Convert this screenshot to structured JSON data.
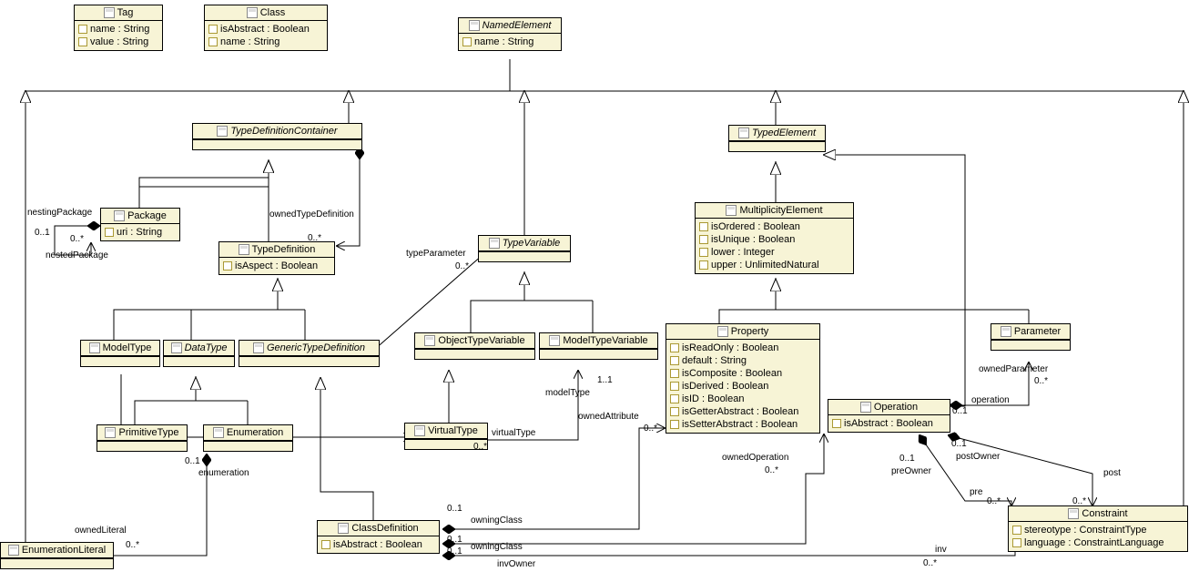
{
  "classes": {
    "Tag": {
      "name": "Tag",
      "italic": false,
      "attrs": [
        "name : String",
        "value : String"
      ]
    },
    "Class": {
      "name": "Class",
      "italic": false,
      "attrs": [
        "isAbstract : Boolean",
        "name : String"
      ]
    },
    "NamedElement": {
      "name": "NamedElement",
      "italic": true,
      "attrs": [
        "name : String"
      ]
    },
    "TypeDefinitionContainer": {
      "name": "TypeDefinitionContainer",
      "italic": true,
      "attrs": []
    },
    "TypedElement": {
      "name": "TypedElement",
      "italic": true,
      "attrs": []
    },
    "Package": {
      "name": "Package",
      "italic": false,
      "attrs": [
        "uri : String"
      ]
    },
    "TypeDefinition": {
      "name": "TypeDefinition",
      "italic": false,
      "attrs": [
        "isAspect : Boolean"
      ]
    },
    "TypeVariable": {
      "name": "TypeVariable",
      "italic": true,
      "attrs": []
    },
    "MultiplicityElement": {
      "name": "MultiplicityElement",
      "italic": false,
      "attrs": [
        "isOrdered : Boolean",
        "isUnique : Boolean",
        "lower : Integer",
        "upper : UnlimitedNatural"
      ]
    },
    "ModelType": {
      "name": "ModelType",
      "italic": false,
      "attrs": []
    },
    "DataType": {
      "name": "DataType",
      "italic": true,
      "attrs": []
    },
    "GenericTypeDefinition": {
      "name": "GenericTypeDefinition",
      "italic": true,
      "attrs": []
    },
    "ObjectTypeVariable": {
      "name": "ObjectTypeVariable",
      "italic": false,
      "attrs": []
    },
    "ModelTypeVariable": {
      "name": "ModelTypeVariable",
      "italic": false,
      "attrs": []
    },
    "Property": {
      "name": "Property",
      "italic": false,
      "attrs": [
        "isReadOnly : Boolean",
        "default : String",
        "isComposite : Boolean",
        "isDerived : Boolean",
        "isID : Boolean",
        "isGetterAbstract : Boolean",
        "isSetterAbstract : Boolean"
      ]
    },
    "Parameter": {
      "name": "Parameter",
      "italic": false,
      "attrs": []
    },
    "Operation": {
      "name": "Operation",
      "italic": false,
      "attrs": [
        "isAbstract : Boolean"
      ]
    },
    "PrimitiveType": {
      "name": "PrimitiveType",
      "italic": false,
      "attrs": []
    },
    "Enumeration": {
      "name": "Enumeration",
      "italic": false,
      "attrs": []
    },
    "VirtualType": {
      "name": "VirtualType",
      "italic": false,
      "attrs": []
    },
    "ClassDefinition": {
      "name": "ClassDefinition",
      "italic": false,
      "attrs": [
        "isAbstract : Boolean"
      ]
    },
    "Constraint": {
      "name": "Constraint",
      "italic": false,
      "attrs": [
        "stereotype : ConstraintType",
        "language : ConstraintLanguage"
      ]
    },
    "EnumerationLiteral": {
      "name": "EnumerationLiteral",
      "italic": false,
      "attrs": []
    }
  },
  "labels": {
    "nestingPackage": "nestingPackage",
    "nestedPackage": "nestedPackage",
    "ownedTypeDefinition": "ownedTypeDefinition",
    "typeParameter": "typeParameter",
    "enumeration": "enumeration",
    "ownedLiteral": "ownedLiteral",
    "virtualType": "virtualType",
    "modelType": "modelType",
    "owningClass": "owningClass",
    "owningClass2": "owningClass",
    "ownedAttribute": "ownedAttribute",
    "ownedOperation": "ownedOperation",
    "invOwner": "invOwner",
    "inv": "inv",
    "pre": "pre",
    "preOwner": "preOwner",
    "post": "post",
    "postOwner": "postOwner",
    "operation": "operation",
    "ownedParameter": "ownedParameter",
    "m01a": "0..1",
    "m0sa": "0..*",
    "m0sb": "0..*",
    "m0sc": "0..*",
    "m11": "1..1",
    "m0sd": "0..*",
    "m01b": "0..1",
    "m0se": "0..*",
    "m0sf": "0..*",
    "m01c": "0..1",
    "m01d": "0..1",
    "m01e": "0..1",
    "m0sg": "0..*",
    "m01f": "0..1",
    "m0sh": "0..*",
    "m01g": "0..1",
    "m0si": "0..*",
    "m01h": "0..1",
    "m0sj": "0..*"
  },
  "chart_data": {
    "type": "uml_class_diagram",
    "classes": [
      {
        "name": "Tag",
        "abstract": false,
        "attributes": [
          {
            "name": "name",
            "type": "String"
          },
          {
            "name": "value",
            "type": "String"
          }
        ]
      },
      {
        "name": "Class",
        "abstract": false,
        "attributes": [
          {
            "name": "isAbstract",
            "type": "Boolean"
          },
          {
            "name": "name",
            "type": "String"
          }
        ]
      },
      {
        "name": "NamedElement",
        "abstract": true,
        "attributes": [
          {
            "name": "name",
            "type": "String"
          }
        ]
      },
      {
        "name": "TypeDefinitionContainer",
        "abstract": true,
        "attributes": []
      },
      {
        "name": "TypedElement",
        "abstract": true,
        "attributes": []
      },
      {
        "name": "Package",
        "abstract": false,
        "attributes": [
          {
            "name": "uri",
            "type": "String"
          }
        ]
      },
      {
        "name": "TypeDefinition",
        "abstract": false,
        "attributes": [
          {
            "name": "isAspect",
            "type": "Boolean"
          }
        ]
      },
      {
        "name": "TypeVariable",
        "abstract": true,
        "attributes": []
      },
      {
        "name": "MultiplicityElement",
        "abstract": false,
        "attributes": [
          {
            "name": "isOrdered",
            "type": "Boolean"
          },
          {
            "name": "isUnique",
            "type": "Boolean"
          },
          {
            "name": "lower",
            "type": "Integer"
          },
          {
            "name": "upper",
            "type": "UnlimitedNatural"
          }
        ]
      },
      {
        "name": "ModelType",
        "abstract": false,
        "attributes": []
      },
      {
        "name": "DataType",
        "abstract": true,
        "attributes": []
      },
      {
        "name": "GenericTypeDefinition",
        "abstract": true,
        "attributes": []
      },
      {
        "name": "ObjectTypeVariable",
        "abstract": false,
        "attributes": []
      },
      {
        "name": "ModelTypeVariable",
        "abstract": false,
        "attributes": []
      },
      {
        "name": "Property",
        "abstract": false,
        "attributes": [
          {
            "name": "isReadOnly",
            "type": "Boolean"
          },
          {
            "name": "default",
            "type": "String"
          },
          {
            "name": "isComposite",
            "type": "Boolean"
          },
          {
            "name": "isDerived",
            "type": "Boolean"
          },
          {
            "name": "isID",
            "type": "Boolean"
          },
          {
            "name": "isGetterAbstract",
            "type": "Boolean"
          },
          {
            "name": "isSetterAbstract",
            "type": "Boolean"
          }
        ]
      },
      {
        "name": "Parameter",
        "abstract": false,
        "attributes": []
      },
      {
        "name": "Operation",
        "abstract": false,
        "attributes": [
          {
            "name": "isAbstract",
            "type": "Boolean"
          }
        ]
      },
      {
        "name": "PrimitiveType",
        "abstract": false,
        "attributes": []
      },
      {
        "name": "Enumeration",
        "abstract": false,
        "attributes": []
      },
      {
        "name": "VirtualType",
        "abstract": false,
        "attributes": []
      },
      {
        "name": "ClassDefinition",
        "abstract": false,
        "attributes": [
          {
            "name": "isAbstract",
            "type": "Boolean"
          }
        ]
      },
      {
        "name": "Constraint",
        "abstract": false,
        "attributes": [
          {
            "name": "stereotype",
            "type": "ConstraintType"
          },
          {
            "name": "language",
            "type": "ConstraintLanguage"
          }
        ]
      },
      {
        "name": "EnumerationLiteral",
        "abstract": false,
        "attributes": []
      }
    ],
    "generalizations": [
      {
        "sub": "TypeDefinitionContainer",
        "super": "NamedElement"
      },
      {
        "sub": "TypedElement",
        "super": "NamedElement"
      },
      {
        "sub": "TypeVariable",
        "super": "NamedElement"
      },
      {
        "sub": "EnumerationLiteral",
        "super": "NamedElement"
      },
      {
        "sub": "Constraint",
        "super": "NamedElement"
      },
      {
        "sub": "Package",
        "super": "TypeDefinitionContainer"
      },
      {
        "sub": "TypeDefinition",
        "super": "TypeDefinitionContainer"
      },
      {
        "sub": "ModelType",
        "super": "TypeDefinition"
      },
      {
        "sub": "DataType",
        "super": "TypeDefinition"
      },
      {
        "sub": "GenericTypeDefinition",
        "super": "TypeDefinition"
      },
      {
        "sub": "PrimitiveType",
        "super": "DataType"
      },
      {
        "sub": "Enumeration",
        "super": "DataType"
      },
      {
        "sub": "ClassDefinition",
        "super": "GenericTypeDefinition"
      },
      {
        "sub": "ObjectTypeVariable",
        "super": "TypeVariable"
      },
      {
        "sub": "ModelTypeVariable",
        "super": "TypeVariable"
      },
      {
        "sub": "VirtualType",
        "super": "ObjectTypeVariable"
      },
      {
        "sub": "MultiplicityElement",
        "super": "TypedElement"
      },
      {
        "sub": "Operation",
        "super": "TypedElement"
      },
      {
        "sub": "Property",
        "super": "MultiplicityElement"
      },
      {
        "sub": "Parameter",
        "super": "MultiplicityElement"
      }
    ],
    "associations": [
      {
        "from": "Package",
        "to": "Package",
        "fromRole": "nestingPackage",
        "fromMult": "0..1",
        "toRole": "nestedPackage",
        "toMult": "0..*",
        "composition": true
      },
      {
        "from": "TypeDefinitionContainer",
        "to": "TypeDefinition",
        "toRole": "ownedTypeDefinition",
        "toMult": "0..*",
        "composition": true
      },
      {
        "from": "GenericTypeDefinition",
        "to": "TypeVariable",
        "toRole": "typeParameter",
        "toMult": "0..*",
        "composition": true
      },
      {
        "from": "Enumeration",
        "to": "EnumerationLiteral",
        "fromRole": "enumeration",
        "fromMult": "0..1",
        "toRole": "ownedLiteral",
        "toMult": "0..*",
        "composition": true
      },
      {
        "from": "ModelType",
        "to": "VirtualType",
        "toRole": "virtualType",
        "toMult": "0..*",
        "composition": false
      },
      {
        "from": "VirtualType",
        "to": "ModelTypeVariable",
        "fromMult": "0..*",
        "toRole": "modelType",
        "toMult": "1..1",
        "composition": false
      },
      {
        "from": "ClassDefinition",
        "to": "Property",
        "fromRole": "owningClass",
        "fromMult": "0..1",
        "toRole": "ownedAttribute",
        "toMult": "0..*",
        "composition": true
      },
      {
        "from": "ClassDefinition",
        "to": "Operation",
        "fromRole": "owningClass",
        "fromMult": "0..1",
        "toRole": "ownedOperation",
        "toMult": "0..*",
        "composition": true
      },
      {
        "from": "ClassDefinition",
        "to": "Constraint",
        "fromRole": "invOwner",
        "fromMult": "0..1",
        "toRole": "inv",
        "toMult": "0..*",
        "composition": true
      },
      {
        "from": "Operation",
        "to": "Constraint",
        "fromRole": "preOwner",
        "fromMult": "0..1",
        "toRole": "pre",
        "toMult": "0..*",
        "composition": true
      },
      {
        "from": "Operation",
        "to": "Constraint",
        "fromRole": "postOwner",
        "fromMult": "0..1",
        "toRole": "post",
        "toMult": "0..*",
        "composition": true
      },
      {
        "from": "Operation",
        "to": "Parameter",
        "fromRole": "operation",
        "fromMult": "0..1",
        "toRole": "ownedParameter",
        "toMult": "0..*",
        "composition": true
      }
    ]
  }
}
